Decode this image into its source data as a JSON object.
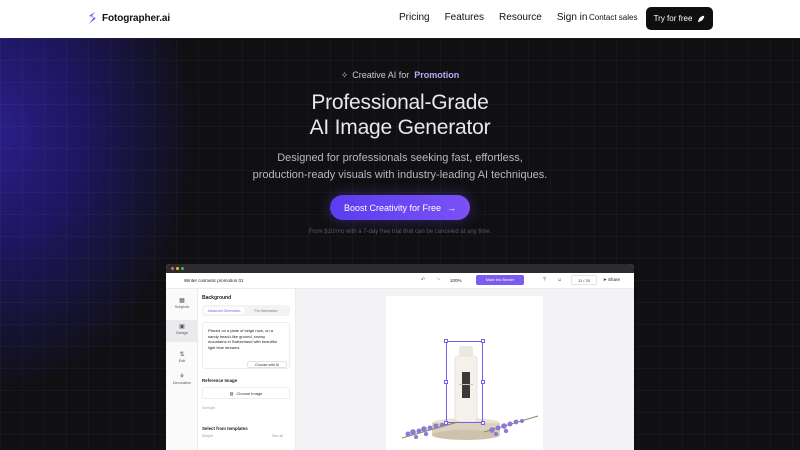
{
  "nav": {
    "brand": "Fotographer.ai",
    "links": [
      "Pricing",
      "Features",
      "Resource",
      "Sign in"
    ],
    "contact": "Contact sales",
    "try_label": "Try for free"
  },
  "hero": {
    "eyebrow_prefix": "Creative AI for",
    "eyebrow_highlight": "Promotion",
    "title_line1": "Professional-Grade",
    "title_line2": "AI Image Generator",
    "subtitle": "Designed for professionals seeking fast, effortless, production-ready visuals with industry-leading AI techniques.",
    "cta_label": "Boost Creativity for Free",
    "cta_arrow": "→",
    "note": "From $10/mo with a 7-day free trial that can be canceled at any time."
  },
  "app": {
    "project_title": "Winter cosmetic promotion 01",
    "zoom": "100%",
    "banner_button": "Make into Banner",
    "credits": "11 / 20",
    "share": "Share",
    "rail": [
      "Subjects",
      "Design",
      "Edit",
      "Decoration"
    ],
    "panel": {
      "heading": "Background",
      "tab_active": "Advanced Generation",
      "tab_inactive": "Pro Generation",
      "prompt": "Placed on a plate of beige rock, on a sandy beach-like ground, snowy mountains in Switzerland with beautiful light blue streams",
      "choose_ai": "Choose with AI",
      "reference_label": "Reference Image",
      "choose_image": "Choose Image",
      "strength": "Strength",
      "templates_label": "Select from templates",
      "simple": "Simple",
      "see_all": "See all"
    }
  },
  "colors": {
    "accent": "#6b4ef2",
    "hero_bg": "#101012",
    "nav_bg": "#ffffff"
  }
}
